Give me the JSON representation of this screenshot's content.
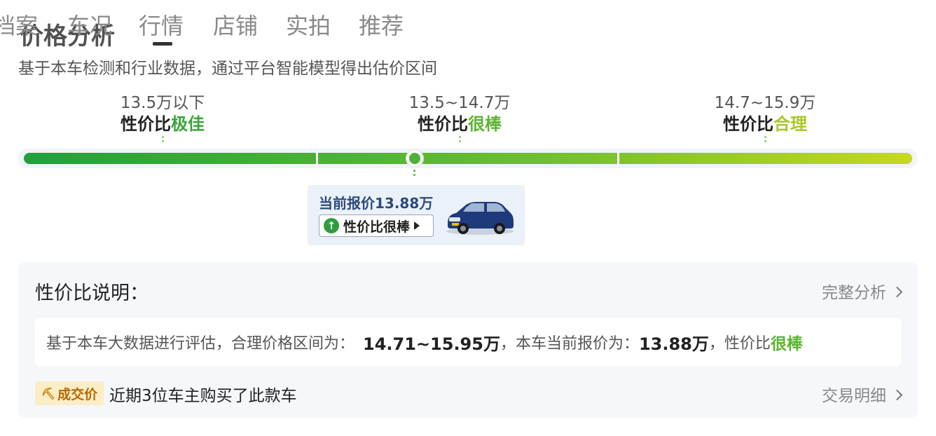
{
  "tabs": [
    "档案",
    "车况",
    "行情",
    "店铺",
    "实拍",
    "推荐"
  ],
  "active_tab": "行情",
  "section": {
    "title": "价格分析",
    "subtitle": "基于本车检测和行业数据，通过平台智能模型得出估价区间"
  },
  "ranges": [
    {
      "price": "13.5万以下",
      "prefix": "性价比",
      "level": "极佳",
      "level_color": "#3aa53a"
    },
    {
      "price": "13.5~14.7万",
      "prefix": "性价比",
      "level": "很棒",
      "level_color": "#5cb531"
    },
    {
      "price": "14.7~15.9万",
      "prefix": "性价比",
      "level": "合理",
      "level_color": "#a6c826"
    }
  ],
  "current": {
    "label": "当前报价13.88万",
    "badge": "性价比很棒",
    "up_icon": "arrow-up-icon",
    "marker_position_fraction": 0.44,
    "car_image": "car-photo"
  },
  "explanation": {
    "title": "性价比说明：",
    "link": "完整分析",
    "text1": "基于本车大数据进行评估，合理价格区间为：",
    "fair_range": "14.71~15.95万",
    "text2": "，本车当前报价为：",
    "current_price": "13.88万",
    "text3": "，性价比",
    "level": "很棒"
  },
  "deals": {
    "badge": "成交价",
    "text": "近期3位车主购买了此款车",
    "link": "交易明细"
  },
  "colors": {
    "accent_green": "#5cb531",
    "price_blue": "#2c4a7c",
    "badge_orange": "#b86a00"
  }
}
